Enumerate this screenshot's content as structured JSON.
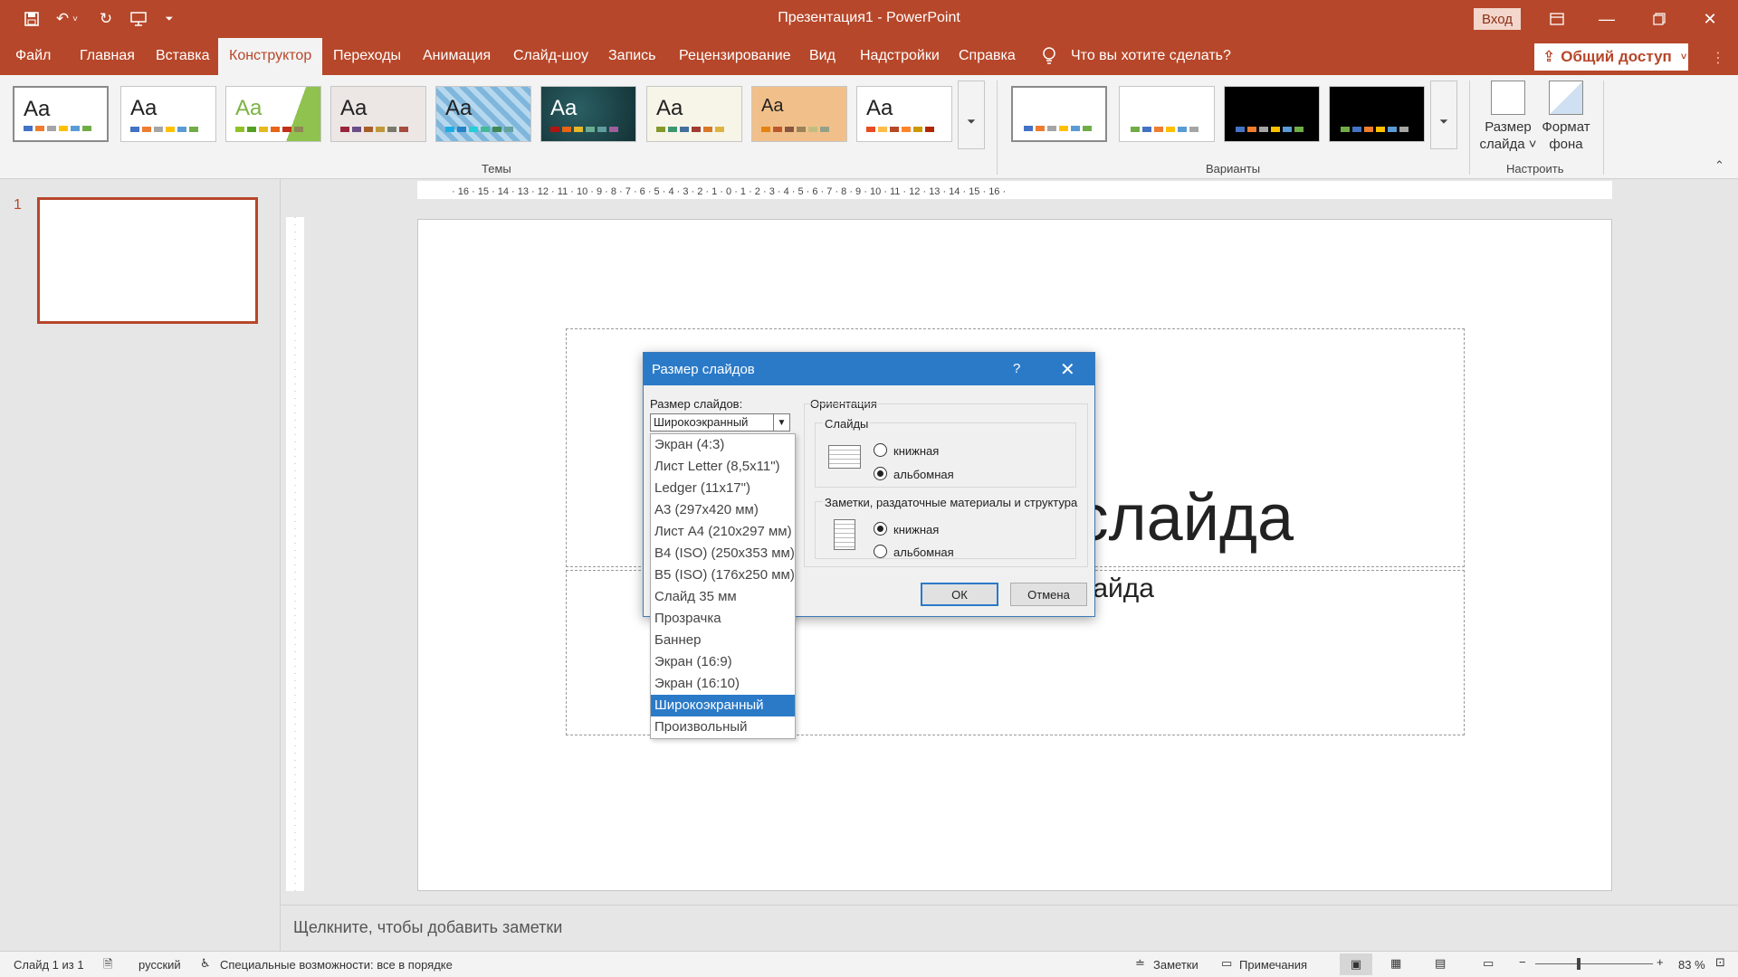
{
  "app": {
    "title": "Презентация1  -  PowerPoint",
    "signin": "Вход"
  },
  "tabs": [
    {
      "label": "Файл"
    },
    {
      "label": "Главная"
    },
    {
      "label": "Вставка"
    },
    {
      "label": "Конструктор"
    },
    {
      "label": "Переходы"
    },
    {
      "label": "Анимация"
    },
    {
      "label": "Слайд-шоу"
    },
    {
      "label": "Запись"
    },
    {
      "label": "Рецензирование"
    },
    {
      "label": "Вид"
    },
    {
      "label": "Надстройки"
    },
    {
      "label": "Справка"
    }
  ],
  "active_tab": "Конструктор",
  "tellme": "Что вы хотите сделать?",
  "share": "Общий доступ",
  "ribbon": {
    "themes_label": "Темы",
    "variants_label": "Варианты",
    "customize_label": "Настроить",
    "theme_sample": "Aa",
    "slide_size_line1": "Размер",
    "slide_size_line2": "слайда ˅",
    "format_bg_line1": "Формат",
    "format_bg_line2": "фона"
  },
  "thumbs": {
    "number": "1"
  },
  "slide": {
    "title_partial": "слайда",
    "subtitle_partial": "айда"
  },
  "notes": {
    "placeholder": "Щелкните, чтобы добавить заметки"
  },
  "status": {
    "slide_count": "Слайд 1 из 1",
    "language": "русский",
    "accessibility": "Специальные возможности: все в порядке",
    "notes_btn": "Заметки",
    "comments_btn": "Примечания",
    "zoom": "83 %"
  },
  "dialog": {
    "title": "Размер слайдов",
    "help": "?",
    "size_label": "Размер слайдов:",
    "size_value": "Широкоэкранный",
    "orientation_label": "Ориентация",
    "slides_label": "Слайды",
    "slides_portrait": "книжная",
    "slides_landscape": "альбомная",
    "notes_label": "Заметки, раздаточные материалы и структура",
    "notes_portrait": "книжная",
    "notes_landscape": "альбомная",
    "ok": "ОК",
    "cancel": "Отмена"
  },
  "size_options": [
    "Экран (4:3)",
    "Лист Letter (8,5x11\")",
    "Ledger (11x17\")",
    "A3 (297x420 мм)",
    "Лист A4 (210x297 мм)",
    "B4 (ISO) (250x353 мм)",
    "B5 (ISO) (176x250 мм)",
    "Слайд 35 мм",
    "Прозрачка",
    "Баннер",
    "Экран (16:9)",
    "Экран (16:10)",
    "Широкоэкранный",
    "Произвольный"
  ],
  "selected_size": "Широкоэкранный",
  "colors": {
    "accent": "#b7472a",
    "dialog_title": "#2b7ac8"
  }
}
